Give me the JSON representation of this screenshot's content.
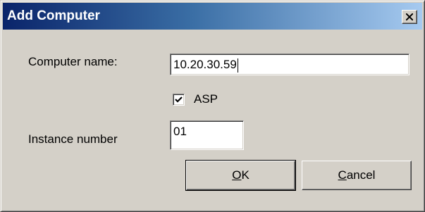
{
  "window": {
    "title": "Add Computer",
    "close_glyph": "×"
  },
  "form": {
    "computer_name_label": "Computer name:",
    "computer_name_value": "10.20.30.59",
    "asp_label": "ASP",
    "asp_checked": true,
    "instance_label": "Instance number",
    "instance_value": "01"
  },
  "buttons": {
    "ok_mnemonic": "O",
    "ok_rest": "K",
    "cancel_mnemonic": "C",
    "cancel_rest": "ancel"
  },
  "icons": {
    "close": "close-icon",
    "check": "checkmark-icon"
  }
}
